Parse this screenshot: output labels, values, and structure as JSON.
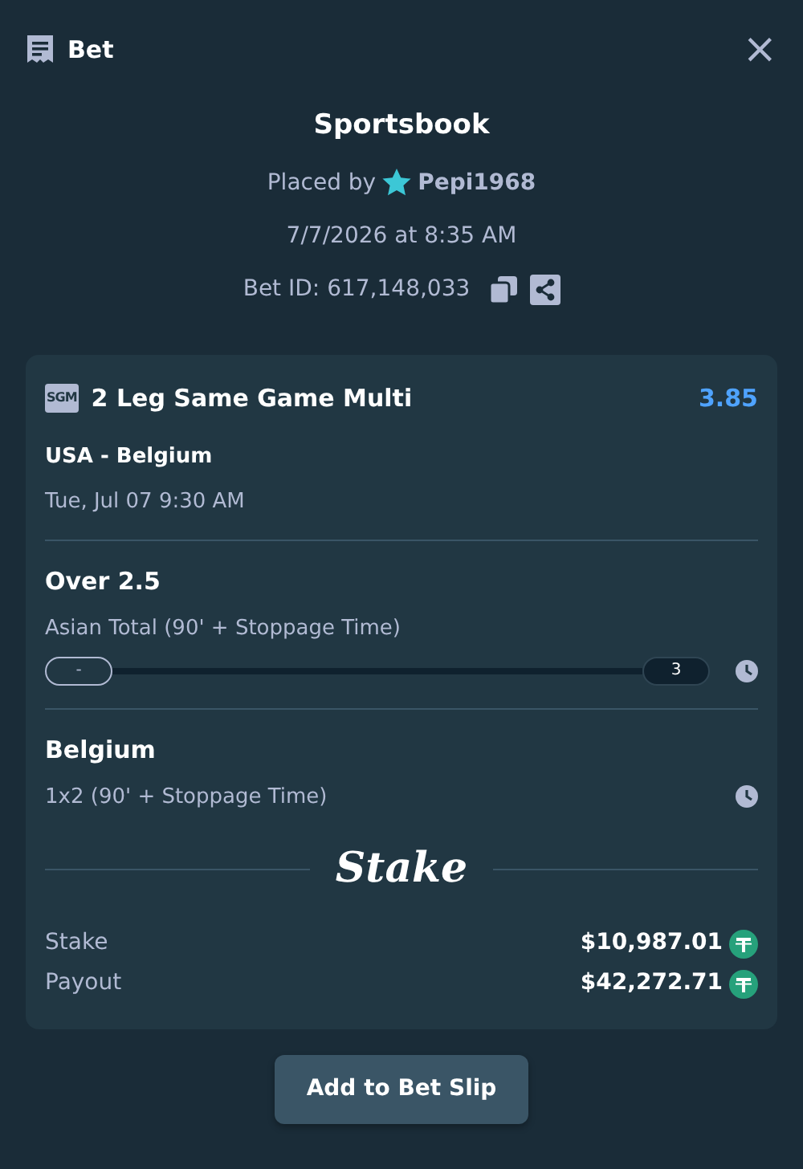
{
  "header": {
    "title": "Bet",
    "close": "×"
  },
  "summary": {
    "title": "Sportsbook",
    "placed_by_label": "Placed by",
    "user": "Pepi1968",
    "date": "7/7/2026 at 8:35 AM",
    "bet_id": "Bet ID: 617,148,033"
  },
  "bet": {
    "badge": "SGM",
    "title": "2 Leg Same Game Multi",
    "odds": "3.85",
    "match": "USA - Belgium",
    "match_time": "Tue, Jul 07 9:30 AM",
    "legs": [
      {
        "kind": "tracker",
        "selection": "Over 2.5",
        "market": "Asian Total (90' + Stoppage Time)",
        "tracker_start": "-",
        "tracker_end": "3"
      },
      {
        "kind": "plain",
        "selection": "Belgium",
        "market": "1x2 (90' + Stoppage Time)"
      }
    ],
    "brand": "Stake",
    "totals": [
      {
        "label": "Stake",
        "amount": "$10,987.01"
      },
      {
        "label": "Payout",
        "amount": "$42,272.71"
      }
    ]
  },
  "action": "Add to Bet Slip"
}
